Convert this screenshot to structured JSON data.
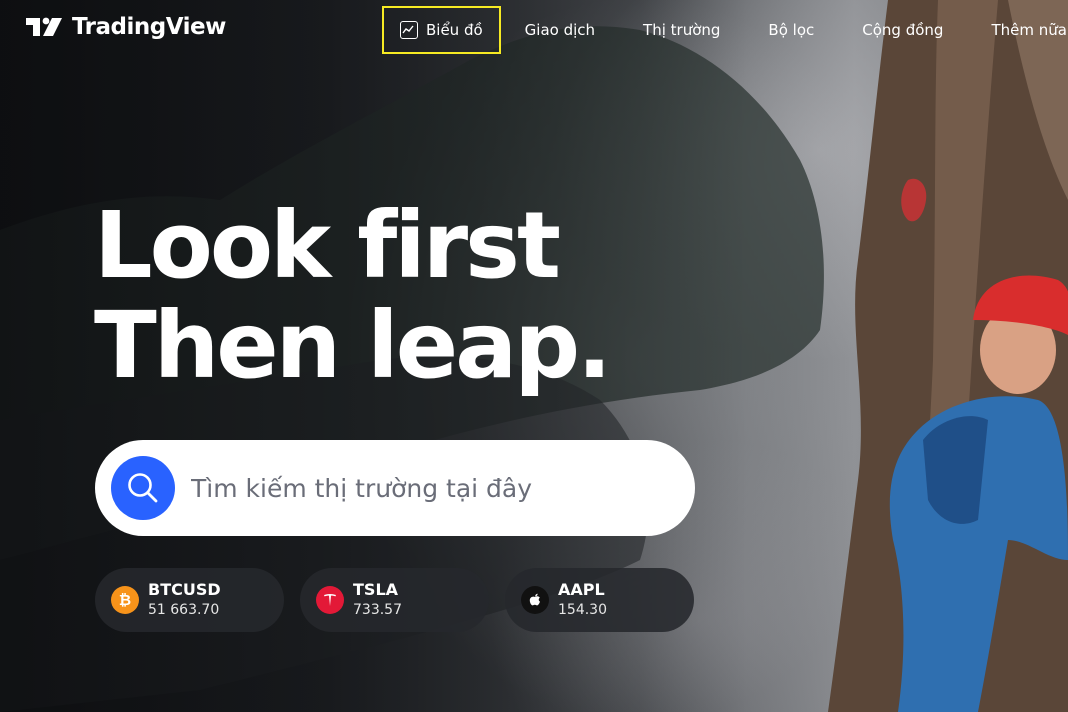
{
  "brand": {
    "name": "TradingView"
  },
  "nav": {
    "items": [
      {
        "label": "Biểu đồ",
        "active": true
      },
      {
        "label": "Giao dịch"
      },
      {
        "label": "Thị trường"
      },
      {
        "label": "Bộ lọc"
      },
      {
        "label": "Cộng đồng"
      },
      {
        "label": "Thêm nữa"
      }
    ]
  },
  "hero": {
    "line1": "Look first",
    "line2": "Then leap."
  },
  "search": {
    "placeholder": "Tìm kiếm thị trường tại đây"
  },
  "tickers": [
    {
      "symbol": "BTCUSD",
      "price": "51 663.70",
      "icon": "bitcoin-icon",
      "color": "#f7931a"
    },
    {
      "symbol": "TSLA",
      "price": "733.57",
      "icon": "tesla-icon",
      "color": "#e31937"
    },
    {
      "symbol": "AAPL",
      "price": "154.30",
      "icon": "apple-icon",
      "color": "#111111"
    }
  ],
  "colors": {
    "accent": "#2962ff",
    "highlight": "#f6ea23"
  }
}
